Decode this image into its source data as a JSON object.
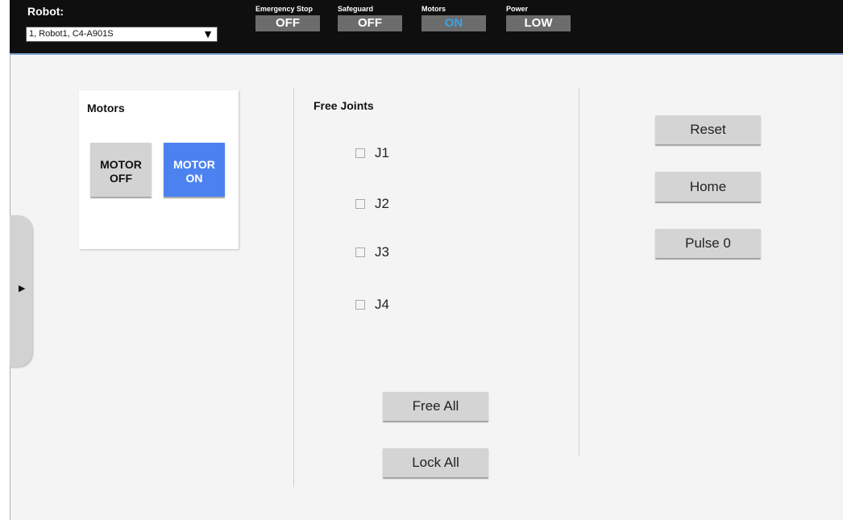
{
  "topbar": {
    "robot_label": "Robot:",
    "robot_selected": "1, Robot1, C4-A901S",
    "status": [
      {
        "label": "Emergency Stop",
        "value": "OFF"
      },
      {
        "label": "Safeguard",
        "value": "OFF"
      },
      {
        "label": "Motors",
        "value": "ON"
      },
      {
        "label": "Power",
        "value": "LOW"
      }
    ]
  },
  "side_tab": {
    "icon": "triangle-right-icon",
    "glyph": "▶"
  },
  "motors": {
    "title": "Motors",
    "off_button": {
      "line1": "MOTOR",
      "line2": "OFF"
    },
    "on_button": {
      "line1": "MOTOR",
      "line2": "ON"
    }
  },
  "free_joints": {
    "title": "Free Joints",
    "joints": [
      {
        "label": "J1",
        "checked": false
      },
      {
        "label": "J2",
        "checked": false
      },
      {
        "label": "J3",
        "checked": false
      },
      {
        "label": "J4",
        "checked": false
      }
    ],
    "free_all_label": "Free All",
    "lock_all_label": "Lock All"
  },
  "actions": {
    "reset_label": "Reset",
    "home_label": "Home",
    "pulse0_label": "Pulse 0"
  },
  "colors": {
    "accent_on": "#4c82f0",
    "status_on_text": "#39a4e4",
    "topbar_bg": "#0f0f0f"
  }
}
